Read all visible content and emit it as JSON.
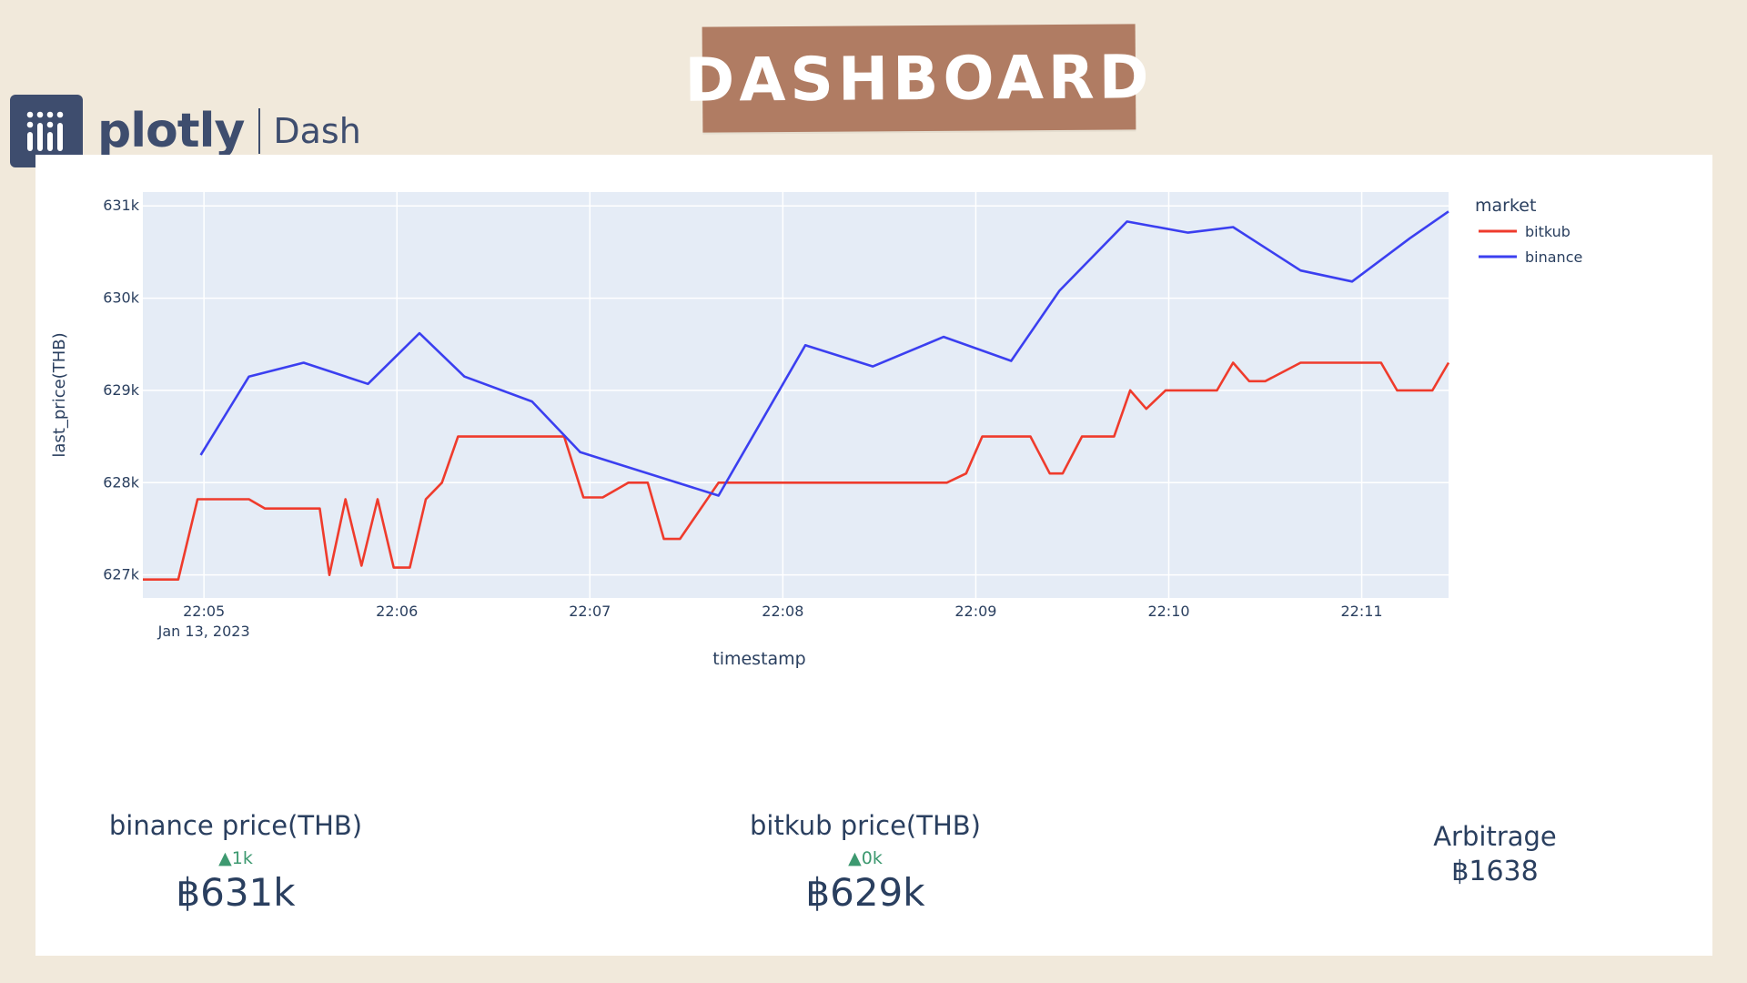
{
  "banner": {
    "title": "DASHBOARD"
  },
  "brand": {
    "logo": "plotly",
    "product": "Dash"
  },
  "chart_data": {
    "type": "line",
    "xlabel": "timestamp",
    "ylabel": "last_price(THB)",
    "legend_title": "market",
    "legend_position": "top-right",
    "grid": true,
    "x_ticks": [
      "22:05",
      "22:06",
      "22:07",
      "22:08",
      "22:09",
      "22:10",
      "22:11"
    ],
    "x_date_label": "Jan 13, 2023",
    "y_ticks": [
      "627k",
      "628k",
      "629k",
      "630k",
      "631k"
    ],
    "y_tick_values": [
      627000,
      628000,
      629000,
      630000,
      631000
    ],
    "xlim": [
      "22:04:41",
      "22:11:27"
    ],
    "ylim": [
      626750,
      631150
    ],
    "series": [
      {
        "name": "bitkub",
        "color": "#ef3b2c",
        "x": [
          "22:04:41",
          "22:04:52",
          "22:04:58",
          "22:05:14",
          "22:05:19",
          "22:05:36",
          "22:05:39",
          "22:05:44",
          "22:05:49",
          "22:05:54",
          "22:05:59",
          "22:06:04",
          "22:06:09",
          "22:06:14",
          "22:06:19",
          "22:06:25",
          "22:06:36",
          "22:06:52",
          "22:06:58",
          "22:07:04",
          "22:07:12",
          "22:07:18",
          "22:07:23",
          "22:07:28",
          "22:07:40",
          "22:07:47",
          "22:07:57",
          "22:08:24",
          "22:08:51",
          "22:08:57",
          "22:09:02",
          "22:09:17",
          "22:09:23",
          "22:09:27",
          "22:09:33",
          "22:09:43",
          "22:09:48",
          "22:09:53",
          "22:09:59",
          "22:10:15",
          "22:10:20",
          "22:10:25",
          "22:10:30",
          "22:10:41",
          "22:10:57",
          "22:11:06",
          "22:11:11",
          "22:11:15",
          "22:11:22",
          "22:11:27"
        ],
        "y": [
          626950,
          626950,
          627820,
          627820,
          627720,
          627720,
          627000,
          627820,
          627100,
          627820,
          627080,
          627080,
          627820,
          628000,
          628500,
          628500,
          628500,
          628500,
          627840,
          627840,
          628000,
          628000,
          627390,
          627390,
          628000,
          628000,
          628000,
          628000,
          628000,
          628100,
          628500,
          628500,
          628100,
          628100,
          628500,
          628500,
          629000,
          628800,
          629000,
          629000,
          629300,
          629100,
          629100,
          629300,
          629300,
          629300,
          629000,
          629000,
          629000,
          629300
        ]
      },
      {
        "name": "binance",
        "color": "#3b3ff0",
        "x": [
          "22:04:59",
          "22:05:14",
          "22:05:31",
          "22:05:51",
          "22:06:07",
          "22:06:21",
          "22:06:42",
          "22:06:57",
          "22:07:40",
          "22:08:07",
          "22:08:28",
          "22:08:50",
          "22:09:11",
          "22:09:26",
          "22:09:47",
          "22:10:06",
          "22:10:20",
          "22:10:41",
          "22:10:57",
          "22:11:15",
          "22:11:27"
        ],
        "y": [
          628300,
          629150,
          629300,
          629070,
          629620,
          629150,
          628880,
          628330,
          627860,
          629490,
          629260,
          629580,
          629320,
          630080,
          630830,
          630710,
          630770,
          630300,
          630180,
          630650,
          630940
        ]
      }
    ]
  },
  "kpis": {
    "binance": {
      "title": "binance price(THB)",
      "delta": "▲1k",
      "value": "฿631k"
    },
    "bitkub": {
      "title": "bitkub price(THB)",
      "delta": "▲0k",
      "value": "฿629k"
    },
    "arbitrage": {
      "title": "Arbitrage",
      "value": "฿1638"
    }
  }
}
